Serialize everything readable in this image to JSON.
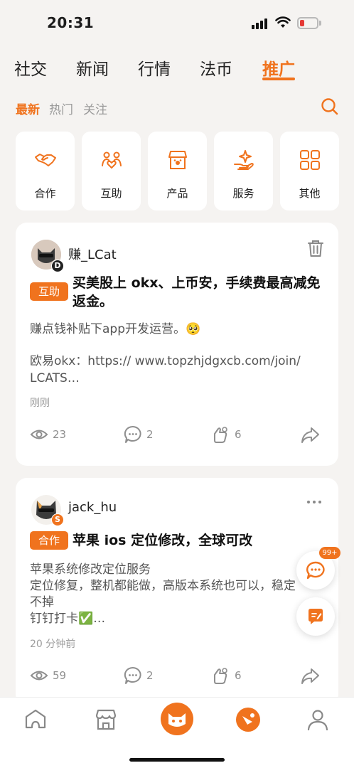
{
  "status_bar": {
    "time": "20:31"
  },
  "top_tabs": [
    {
      "label": "社交"
    },
    {
      "label": "新闻"
    },
    {
      "label": "行情"
    },
    {
      "label": "法币"
    },
    {
      "label": "推广",
      "active": true
    }
  ],
  "sub_tabs": [
    {
      "label": "最新",
      "active": true
    },
    {
      "label": "热门"
    },
    {
      "label": "关注"
    }
  ],
  "categories": [
    {
      "label": "合作",
      "icon": "handshake-icon"
    },
    {
      "label": "互助",
      "icon": "mutual-help-icon"
    },
    {
      "label": "产品",
      "icon": "shop-icon"
    },
    {
      "label": "服务",
      "icon": "service-icon"
    },
    {
      "label": "其他",
      "icon": "grid-icon"
    }
  ],
  "posts": [
    {
      "author": "赚_LCat",
      "author_badge": "D",
      "tag": "互助",
      "title": "买美股上 okx、上币安，手续费最高减免返金。",
      "body_line1": "赚点钱补贴下app开发运营。🥺",
      "body_line2": "欧易okx：https:// www.topzhjdgxcb.com/join/",
      "body_line3": "LCATS…",
      "time": "刚刚",
      "views": "23",
      "comments": "2",
      "likes": "6"
    },
    {
      "author": "jack_hu",
      "author_badge": "S",
      "tag": "合作",
      "title": "苹果 ios 定位修改，全球可改",
      "body_line1": "苹果系统修改定位服务",
      "body_line2": "定位修复，整机都能做，高版本系统也可以，稳定",
      "body_line3": "不掉",
      "body_line4": "钉钉打卡✅…",
      "time": "20 分钟前",
      "views": "59",
      "comments": "2",
      "likes": "6"
    }
  ],
  "floating": {
    "message_count": "99+"
  },
  "colors": {
    "accent": "#f0731e",
    "background": "#f5f3f1"
  }
}
